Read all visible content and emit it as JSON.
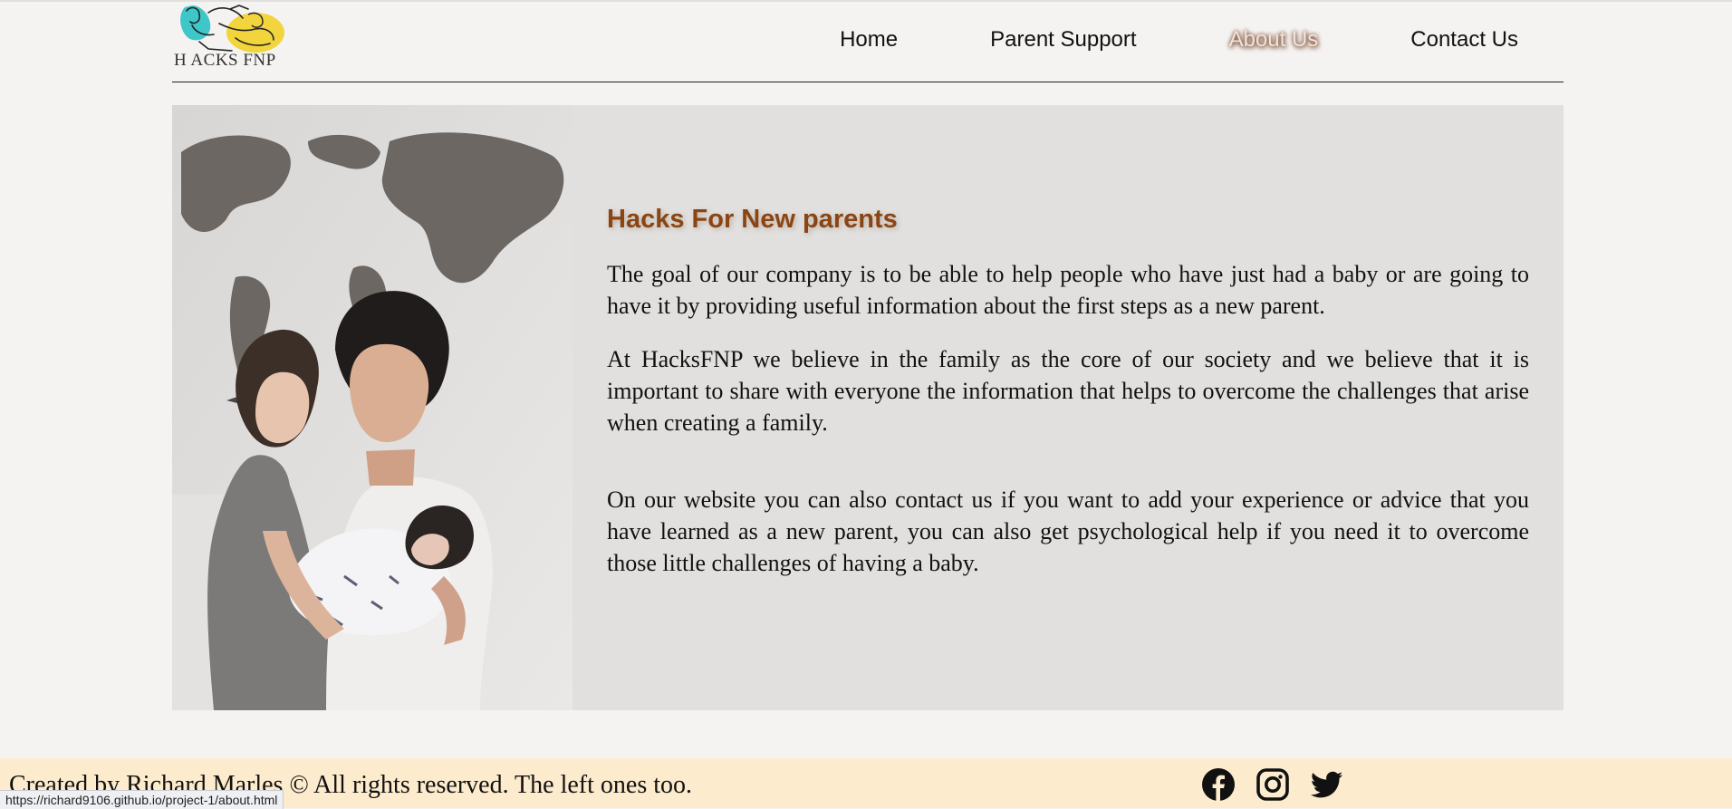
{
  "logo": {
    "text": "H ACKS FNP"
  },
  "nav": {
    "items": [
      {
        "label": "Home"
      },
      {
        "label": "Parent Support"
      },
      {
        "label": "About Us"
      },
      {
        "label": "Contact Us"
      }
    ],
    "active": "About Us"
  },
  "about": {
    "heading": "Hacks For New parents",
    "paragraphs": [
      "The goal of our company is to be able to help people who have just had a baby or are going to have it by providing useful information about the first steps as a new parent.",
      "At HacksFNP we believe in the family as the core of our society and we believe that it is important to share with everyone the information that helps to overcome the challenges that arise when creating a family.",
      "On our website you can also contact us if you want to add your experience or advice that you have learned as a new parent, you can also get psychological help if you need it to overcome those little challenges of having a baby."
    ]
  },
  "footer": {
    "copyright": "Created by Richard Marles © All rights reserved. The left ones too.",
    "socials": [
      "facebook-icon",
      "instagram-icon",
      "twitter-icon"
    ]
  },
  "status_bar": {
    "url": "https://richard9106.github.io/project-1/about.html"
  },
  "colors": {
    "background": "#f5f3f2",
    "card": "#e1e0df",
    "heading": "#8b4513",
    "footer": "#fdebcd"
  }
}
